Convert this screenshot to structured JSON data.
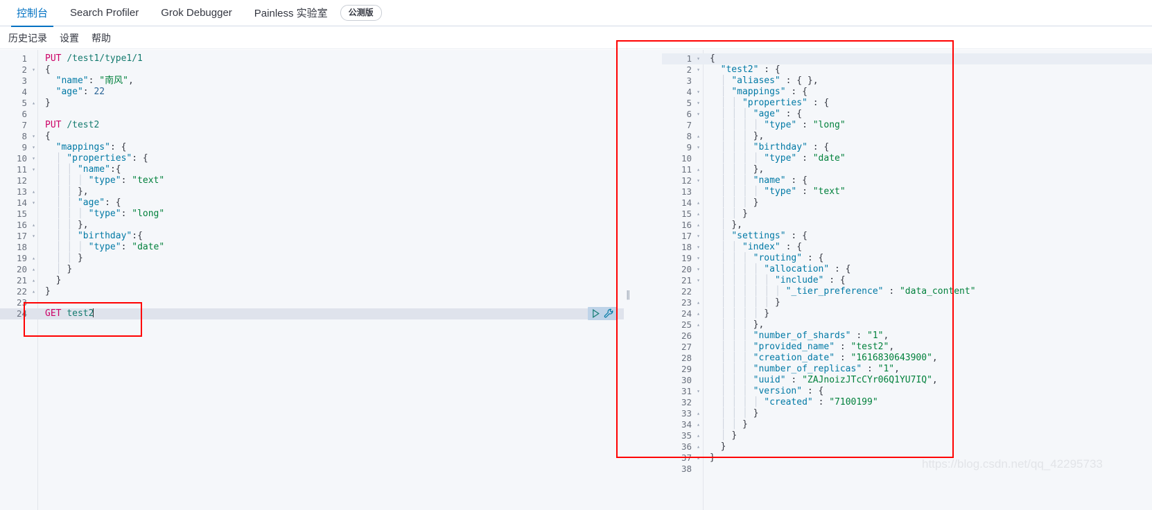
{
  "tabs": [
    {
      "label": "控制台",
      "active": true
    },
    {
      "label": "Search Profiler",
      "active": false
    },
    {
      "label": "Grok Debugger",
      "active": false
    },
    {
      "label": "Painless 实验室",
      "active": false
    }
  ],
  "beta_badge": "公测版",
  "submenu": [
    {
      "label": "历史记录"
    },
    {
      "label": "设置"
    },
    {
      "label": "帮助"
    }
  ],
  "actions": {
    "play_icon": "play-triangle-icon",
    "wrench_icon": "wrench-icon"
  },
  "splitter": {
    "grip": "‖"
  },
  "watermark": "https://blog.csdn.net/qq_42295733",
  "request_editor": {
    "name": "console-request-editor",
    "active_line": 24,
    "lines": [
      {
        "n": 1,
        "fold": "",
        "html": "<span class='t-method'>PUT</span> <span class='t-url'>/test1/type1/1</span>"
      },
      {
        "n": 2,
        "fold": "▾",
        "html": "<span class='t-punc'>{</span>"
      },
      {
        "n": 3,
        "fold": "",
        "html": "  <span class='t-key'>\"name\"</span><span class='t-punc'>:</span> <span class='t-cn'>\"南风\"</span><span class='t-punc'>,</span>"
      },
      {
        "n": 4,
        "fold": "",
        "html": "  <span class='t-key'>\"age\"</span><span class='t-punc'>:</span> <span class='t-num'>22</span>"
      },
      {
        "n": 5,
        "fold": "▴",
        "html": "<span class='t-punc'>}</span>"
      },
      {
        "n": 6,
        "fold": "",
        "html": ""
      },
      {
        "n": 7,
        "fold": "",
        "html": "<span class='t-method'>PUT</span> <span class='t-url'>/test2</span>"
      },
      {
        "n": 8,
        "fold": "▾",
        "html": "<span class='t-punc'>{</span>"
      },
      {
        "n": 9,
        "fold": "▾",
        "html": "  <span class='t-key'>\"mappings\"</span><span class='t-punc'>:</span> <span class='t-punc'>{</span>"
      },
      {
        "n": 10,
        "fold": "▾",
        "html": "  <span class='ig'>│</span> <span class='t-key'>\"properties\"</span><span class='t-punc'>:</span> <span class='t-punc'>{</span>"
      },
      {
        "n": 11,
        "fold": "▾",
        "html": "  <span class='ig'>│</span> <span class='ig'>│</span> <span class='t-key'>\"name\"</span><span class='t-punc'>:{</span>"
      },
      {
        "n": 12,
        "fold": "",
        "html": "  <span class='ig'>│</span> <span class='ig'>│</span> <span class='ig'>│</span> <span class='t-key'>\"type\"</span><span class='t-punc'>:</span> <span class='t-str'>\"text\"</span>"
      },
      {
        "n": 13,
        "fold": "▴",
        "html": "  <span class='ig'>│</span> <span class='ig'>│</span> <span class='t-punc'>},</span>"
      },
      {
        "n": 14,
        "fold": "▾",
        "html": "  <span class='ig'>│</span> <span class='ig'>│</span> <span class='t-key'>\"age\"</span><span class='t-punc'>:</span> <span class='t-punc'>{</span>"
      },
      {
        "n": 15,
        "fold": "",
        "html": "  <span class='ig'>│</span> <span class='ig'>│</span> <span class='ig'>│</span> <span class='t-key'>\"type\"</span><span class='t-punc'>:</span> <span class='t-str'>\"long\"</span>"
      },
      {
        "n": 16,
        "fold": "▴",
        "html": "  <span class='ig'>│</span> <span class='ig'>│</span> <span class='t-punc'>},</span>"
      },
      {
        "n": 17,
        "fold": "▾",
        "html": "  <span class='ig'>│</span> <span class='ig'>│</span> <span class='t-key'>\"birthday\"</span><span class='t-punc'>:{</span>"
      },
      {
        "n": 18,
        "fold": "",
        "html": "  <span class='ig'>│</span> <span class='ig'>│</span> <span class='ig'>│</span> <span class='t-key'>\"type\"</span><span class='t-punc'>:</span> <span class='t-str'>\"date\"</span>"
      },
      {
        "n": 19,
        "fold": "▴",
        "html": "  <span class='ig'>│</span> <span class='ig'>│</span> <span class='t-punc'>}</span>"
      },
      {
        "n": 20,
        "fold": "▴",
        "html": "  <span class='ig'>│</span> <span class='t-punc'>}</span>"
      },
      {
        "n": 21,
        "fold": "▴",
        "html": "  <span class='t-punc'>}</span>"
      },
      {
        "n": 22,
        "fold": "▴",
        "html": "<span class='t-punc'>}</span>"
      },
      {
        "n": 23,
        "fold": "",
        "html": ""
      },
      {
        "n": 24,
        "fold": "",
        "html": "<span class='t-method'>GET</span> <span class='t-url'>test2</span><span class='caret'></span>"
      }
    ]
  },
  "response_editor": {
    "name": "console-response-editor",
    "active_line": 1,
    "lines": [
      {
        "n": 1,
        "fold": "▾",
        "html": "<span class='t-punc'>{</span>"
      },
      {
        "n": 2,
        "fold": "▾",
        "html": "  <span class='t-key'>\"test2\"</span> <span class='t-punc'>: {</span>"
      },
      {
        "n": 3,
        "fold": "",
        "html": "  <span class='ig'>│</span> <span class='t-key'>\"aliases\"</span> <span class='t-punc'>: { },</span>"
      },
      {
        "n": 4,
        "fold": "▾",
        "html": "  <span class='ig'>│</span> <span class='t-key'>\"mappings\"</span> <span class='t-punc'>: {</span>"
      },
      {
        "n": 5,
        "fold": "▾",
        "html": "  <span class='ig'>│</span> <span class='ig'>│</span> <span class='t-key'>\"properties\"</span> <span class='t-punc'>: {</span>"
      },
      {
        "n": 6,
        "fold": "▾",
        "html": "  <span class='ig'>│</span> <span class='ig'>│</span> <span class='ig'>│</span> <span class='t-key'>\"age\"</span> <span class='t-punc'>: {</span>"
      },
      {
        "n": 7,
        "fold": "",
        "html": "  <span class='ig'>│</span> <span class='ig'>│</span> <span class='ig'>│</span> <span class='ig'>│</span> <span class='t-key'>\"type\"</span> <span class='t-punc'>:</span> <span class='t-str'>\"long\"</span>"
      },
      {
        "n": 8,
        "fold": "▴",
        "html": "  <span class='ig'>│</span> <span class='ig'>│</span> <span class='ig'>│</span> <span class='t-punc'>},</span>"
      },
      {
        "n": 9,
        "fold": "▾",
        "html": "  <span class='ig'>│</span> <span class='ig'>│</span> <span class='ig'>│</span> <span class='t-key'>\"birthday\"</span> <span class='t-punc'>: {</span>"
      },
      {
        "n": 10,
        "fold": "",
        "html": "  <span class='ig'>│</span> <span class='ig'>│</span> <span class='ig'>│</span> <span class='ig'>│</span> <span class='t-key'>\"type\"</span> <span class='t-punc'>:</span> <span class='t-str'>\"date\"</span>"
      },
      {
        "n": 11,
        "fold": "▴",
        "html": "  <span class='ig'>│</span> <span class='ig'>│</span> <span class='ig'>│</span> <span class='t-punc'>},</span>"
      },
      {
        "n": 12,
        "fold": "▾",
        "html": "  <span class='ig'>│</span> <span class='ig'>│</span> <span class='ig'>│</span> <span class='t-key'>\"name\"</span> <span class='t-punc'>: {</span>"
      },
      {
        "n": 13,
        "fold": "",
        "html": "  <span class='ig'>│</span> <span class='ig'>│</span> <span class='ig'>│</span> <span class='ig'>│</span> <span class='t-key'>\"type\"</span> <span class='t-punc'>:</span> <span class='t-str'>\"text\"</span>"
      },
      {
        "n": 14,
        "fold": "▴",
        "html": "  <span class='ig'>│</span> <span class='ig'>│</span> <span class='ig'>│</span> <span class='t-punc'>}</span>"
      },
      {
        "n": 15,
        "fold": "▴",
        "html": "  <span class='ig'>│</span> <span class='ig'>│</span> <span class='t-punc'>}</span>"
      },
      {
        "n": 16,
        "fold": "▴",
        "html": "  <span class='ig'>│</span> <span class='t-punc'>},</span>"
      },
      {
        "n": 17,
        "fold": "▾",
        "html": "  <span class='ig'>│</span> <span class='t-key'>\"settings\"</span> <span class='t-punc'>: {</span>"
      },
      {
        "n": 18,
        "fold": "▾",
        "html": "  <span class='ig'>│</span> <span class='ig'>│</span> <span class='t-key'>\"index\"</span> <span class='t-punc'>: {</span>"
      },
      {
        "n": 19,
        "fold": "▾",
        "html": "  <span class='ig'>│</span> <span class='ig'>│</span> <span class='ig'>│</span> <span class='t-key'>\"routing\"</span> <span class='t-punc'>: {</span>"
      },
      {
        "n": 20,
        "fold": "▾",
        "html": "  <span class='ig'>│</span> <span class='ig'>│</span> <span class='ig'>│</span> <span class='ig'>│</span> <span class='t-key'>\"allocation\"</span> <span class='t-punc'>: {</span>"
      },
      {
        "n": 21,
        "fold": "▾",
        "html": "  <span class='ig'>│</span> <span class='ig'>│</span> <span class='ig'>│</span> <span class='ig'>│</span> <span class='ig'>│</span> <span class='t-key'>\"include\"</span> <span class='t-punc'>: {</span>"
      },
      {
        "n": 22,
        "fold": "",
        "html": "  <span class='ig'>│</span> <span class='ig'>│</span> <span class='ig'>│</span> <span class='ig'>│</span> <span class='ig'>│</span> <span class='ig'>│</span> <span class='t-key'>\"_tier_preference\"</span> <span class='t-punc'>:</span> <span class='t-str'>\"data_content\"</span>"
      },
      {
        "n": 23,
        "fold": "▴",
        "html": "  <span class='ig'>│</span> <span class='ig'>│</span> <span class='ig'>│</span> <span class='ig'>│</span> <span class='ig'>│</span> <span class='t-punc'>}</span>"
      },
      {
        "n": 24,
        "fold": "▴",
        "html": "  <span class='ig'>│</span> <span class='ig'>│</span> <span class='ig'>│</span> <span class='ig'>│</span> <span class='t-punc'>}</span>"
      },
      {
        "n": 25,
        "fold": "▴",
        "html": "  <span class='ig'>│</span> <span class='ig'>│</span> <span class='ig'>│</span> <span class='t-punc'>},</span>"
      },
      {
        "n": 26,
        "fold": "",
        "html": "  <span class='ig'>│</span> <span class='ig'>│</span> <span class='ig'>│</span> <span class='t-key'>\"number_of_shards\"</span> <span class='t-punc'>:</span> <span class='t-str'>\"1\"</span><span class='t-punc'>,</span>"
      },
      {
        "n": 27,
        "fold": "",
        "html": "  <span class='ig'>│</span> <span class='ig'>│</span> <span class='ig'>│</span> <span class='t-key'>\"provided_name\"</span> <span class='t-punc'>:</span> <span class='t-str'>\"test2\"</span><span class='t-punc'>,</span>"
      },
      {
        "n": 28,
        "fold": "",
        "html": "  <span class='ig'>│</span> <span class='ig'>│</span> <span class='ig'>│</span> <span class='t-key'>\"creation_date\"</span> <span class='t-punc'>:</span> <span class='t-str'>\"1616830643900\"</span><span class='t-punc'>,</span>"
      },
      {
        "n": 29,
        "fold": "",
        "html": "  <span class='ig'>│</span> <span class='ig'>│</span> <span class='ig'>│</span> <span class='t-key'>\"number_of_replicas\"</span> <span class='t-punc'>:</span> <span class='t-str'>\"1\"</span><span class='t-punc'>,</span>"
      },
      {
        "n": 30,
        "fold": "",
        "html": "  <span class='ig'>│</span> <span class='ig'>│</span> <span class='ig'>│</span> <span class='t-key'>\"uuid\"</span> <span class='t-punc'>:</span> <span class='t-str'>\"ZAJnoizJTcCYr06Q1YU7IQ\"</span><span class='t-punc'>,</span>"
      },
      {
        "n": 31,
        "fold": "▾",
        "html": "  <span class='ig'>│</span> <span class='ig'>│</span> <span class='ig'>│</span> <span class='t-key'>\"version\"</span> <span class='t-punc'>: {</span>"
      },
      {
        "n": 32,
        "fold": "",
        "html": "  <span class='ig'>│</span> <span class='ig'>│</span> <span class='ig'>│</span> <span class='ig'>│</span> <span class='t-key'>\"created\"</span> <span class='t-punc'>:</span> <span class='t-str'>\"7100199\"</span>"
      },
      {
        "n": 33,
        "fold": "▴",
        "html": "  <span class='ig'>│</span> <span class='ig'>│</span> <span class='ig'>│</span> <span class='t-punc'>}</span>"
      },
      {
        "n": 34,
        "fold": "▴",
        "html": "  <span class='ig'>│</span> <span class='ig'>│</span> <span class='t-punc'>}</span>"
      },
      {
        "n": 35,
        "fold": "▴",
        "html": "  <span class='ig'>│</span> <span class='t-punc'>}</span>"
      },
      {
        "n": 36,
        "fold": "▴",
        "html": "  <span class='t-punc'>}</span>"
      },
      {
        "n": 37,
        "fold": "▴",
        "html": "<span class='t-punc'>}</span>"
      },
      {
        "n": 38,
        "fold": "",
        "html": ""
      }
    ]
  }
}
